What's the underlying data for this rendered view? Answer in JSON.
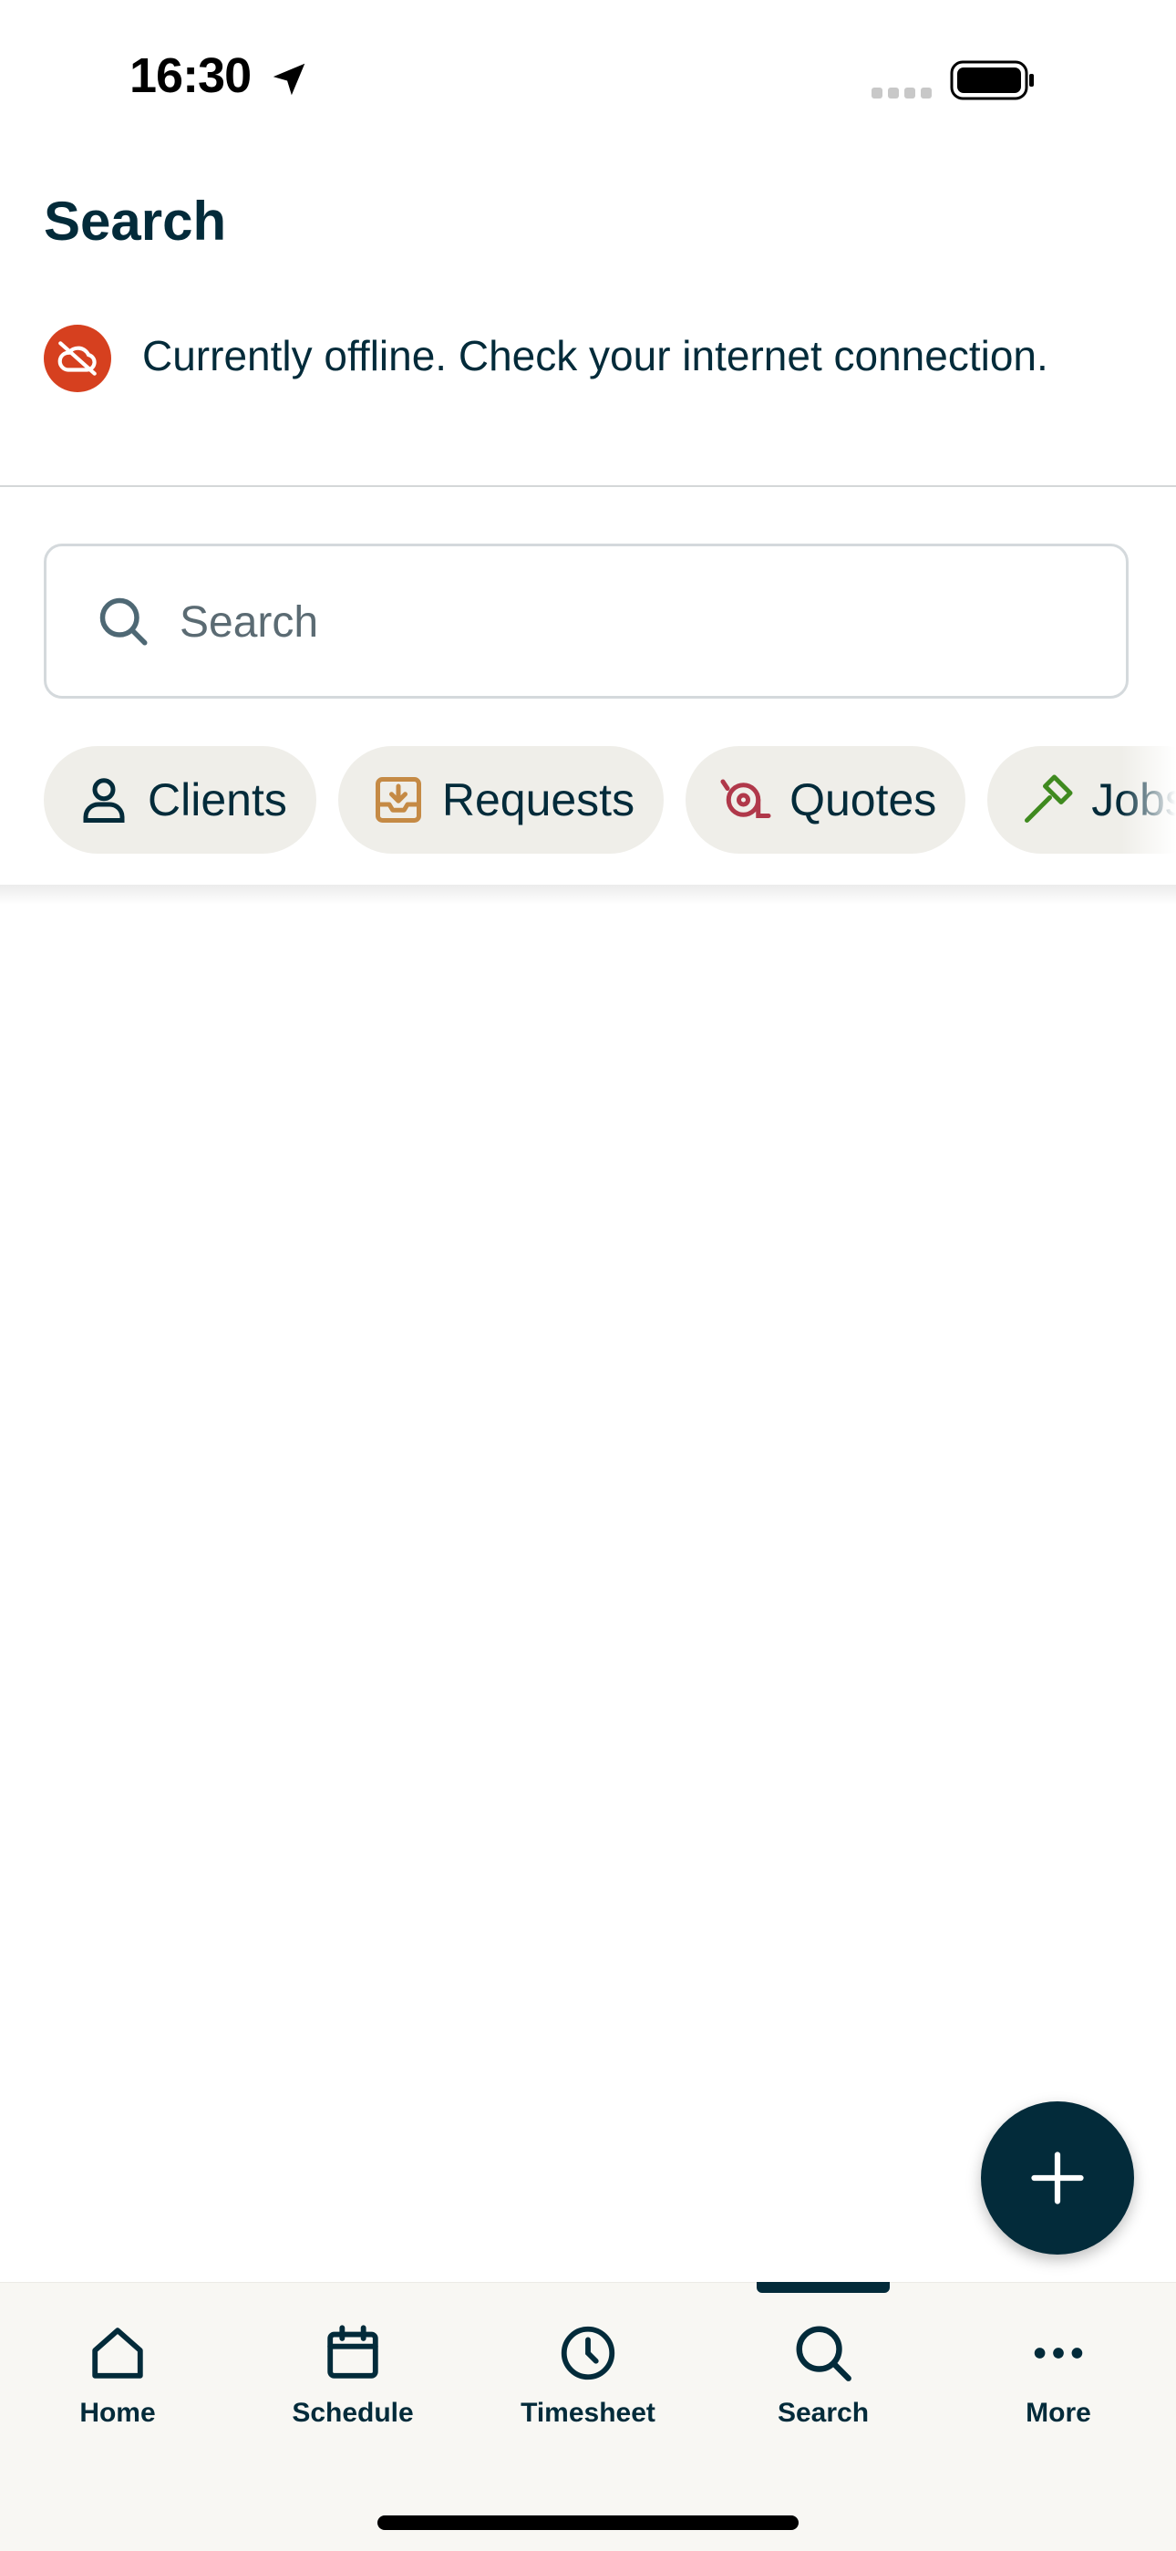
{
  "status_bar": {
    "time": "16:30"
  },
  "header": {
    "title": "Search"
  },
  "offline_banner": {
    "message": "Currently offline. Check your internet connection."
  },
  "search": {
    "placeholder": "Search",
    "value": ""
  },
  "filter_chips": [
    {
      "label": "Clients",
      "icon": "person-icon",
      "color": "#032b3a"
    },
    {
      "label": "Requests",
      "icon": "inbox-download-icon",
      "color": "#c58a45"
    },
    {
      "label": "Quotes",
      "icon": "quote-icon",
      "color": "#b0384a"
    },
    {
      "label": "Jobs",
      "icon": "hammer-icon",
      "color": "#3f8a1f"
    }
  ],
  "fab": {
    "icon": "plus-icon"
  },
  "tab_bar": {
    "active": "Search",
    "items": [
      {
        "label": "Home",
        "icon": "home-icon"
      },
      {
        "label": "Schedule",
        "icon": "calendar-icon"
      },
      {
        "label": "Timesheet",
        "icon": "clock-icon"
      },
      {
        "label": "Search",
        "icon": "search-icon"
      },
      {
        "label": "More",
        "icon": "more-icon"
      }
    ]
  },
  "colors": {
    "primary": "#032b3a",
    "offline": "#d6401f",
    "chip_bg": "#efeee9",
    "tab_bar_bg": "#f8f7f3"
  }
}
